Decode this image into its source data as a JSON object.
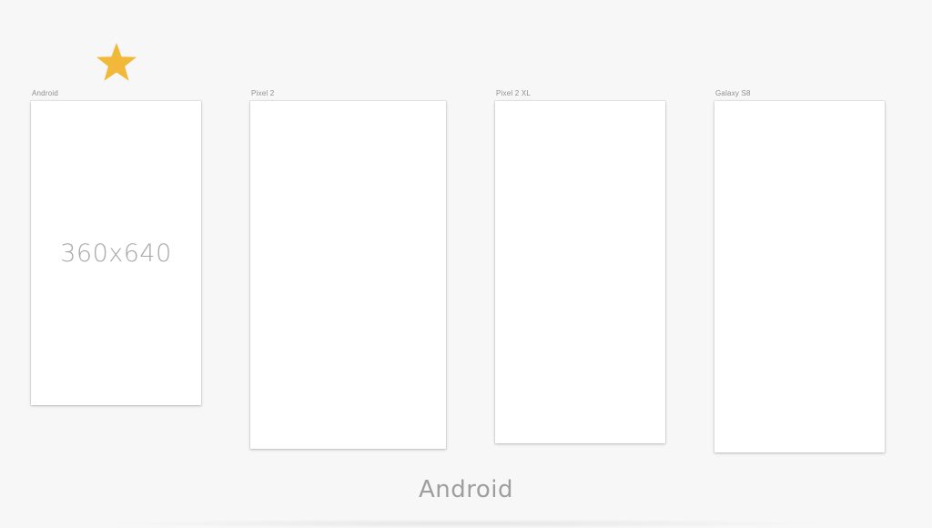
{
  "favorite": {
    "icon": "star-icon",
    "color": "#f2b83a"
  },
  "frames": [
    {
      "label": "Android",
      "size_text": "360x640"
    },
    {
      "label": "Pixel 2",
      "size_text": ""
    },
    {
      "label": "Pixel 2 XL",
      "size_text": ""
    },
    {
      "label": "Galaxy S8",
      "size_text": ""
    }
  ],
  "platform_title": "Android",
  "colors": {
    "background": "#f7f7f7",
    "frame": "#ffffff",
    "label_text": "#8e8e8e",
    "size_text": "#a9a9a9"
  }
}
